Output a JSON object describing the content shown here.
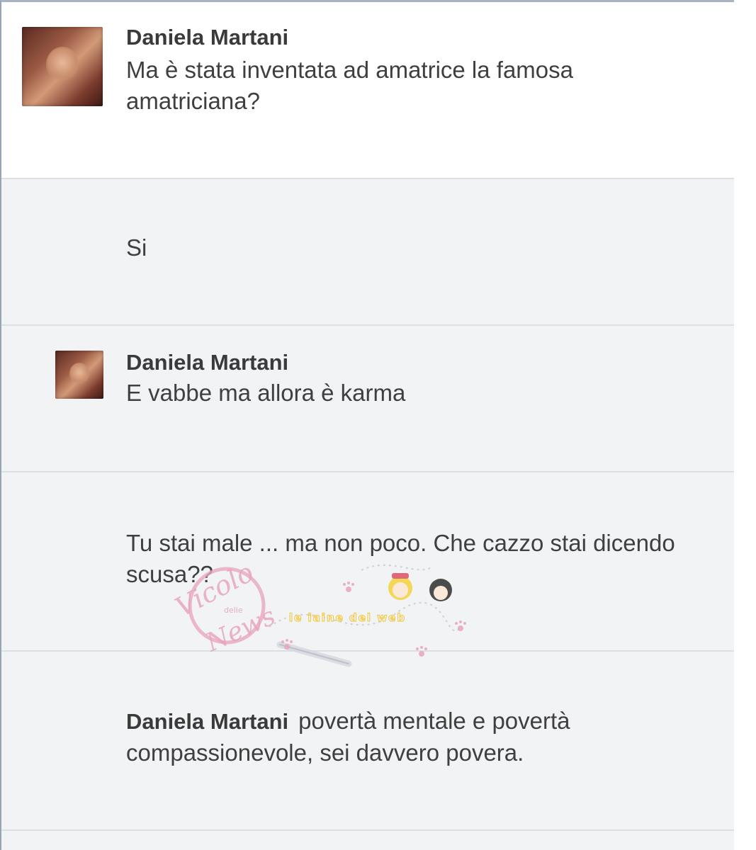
{
  "comments": [
    {
      "author": "Daniela Martani",
      "text": "Ma è stata inventata ad amatrice la famosa amatriciana?"
    },
    {
      "author": "",
      "text": "Si"
    },
    {
      "author": "Daniela Martani",
      "text": "E vabbe ma allora è karma"
    },
    {
      "author": "",
      "text": "Tu stai male ... ma non poco. Che cazzo stai dicendo scusa??"
    },
    {
      "author": "Daniela Martani",
      "text": "povertà mentale e povertà compassionevole, sei davvero povera."
    }
  ],
  "watermark": {
    "left_script": "Vicolo",
    "left_small": "delle",
    "left_bottom": "News",
    "right_text": "le iaine del web",
    "brand_color": "#e8a5c0"
  }
}
